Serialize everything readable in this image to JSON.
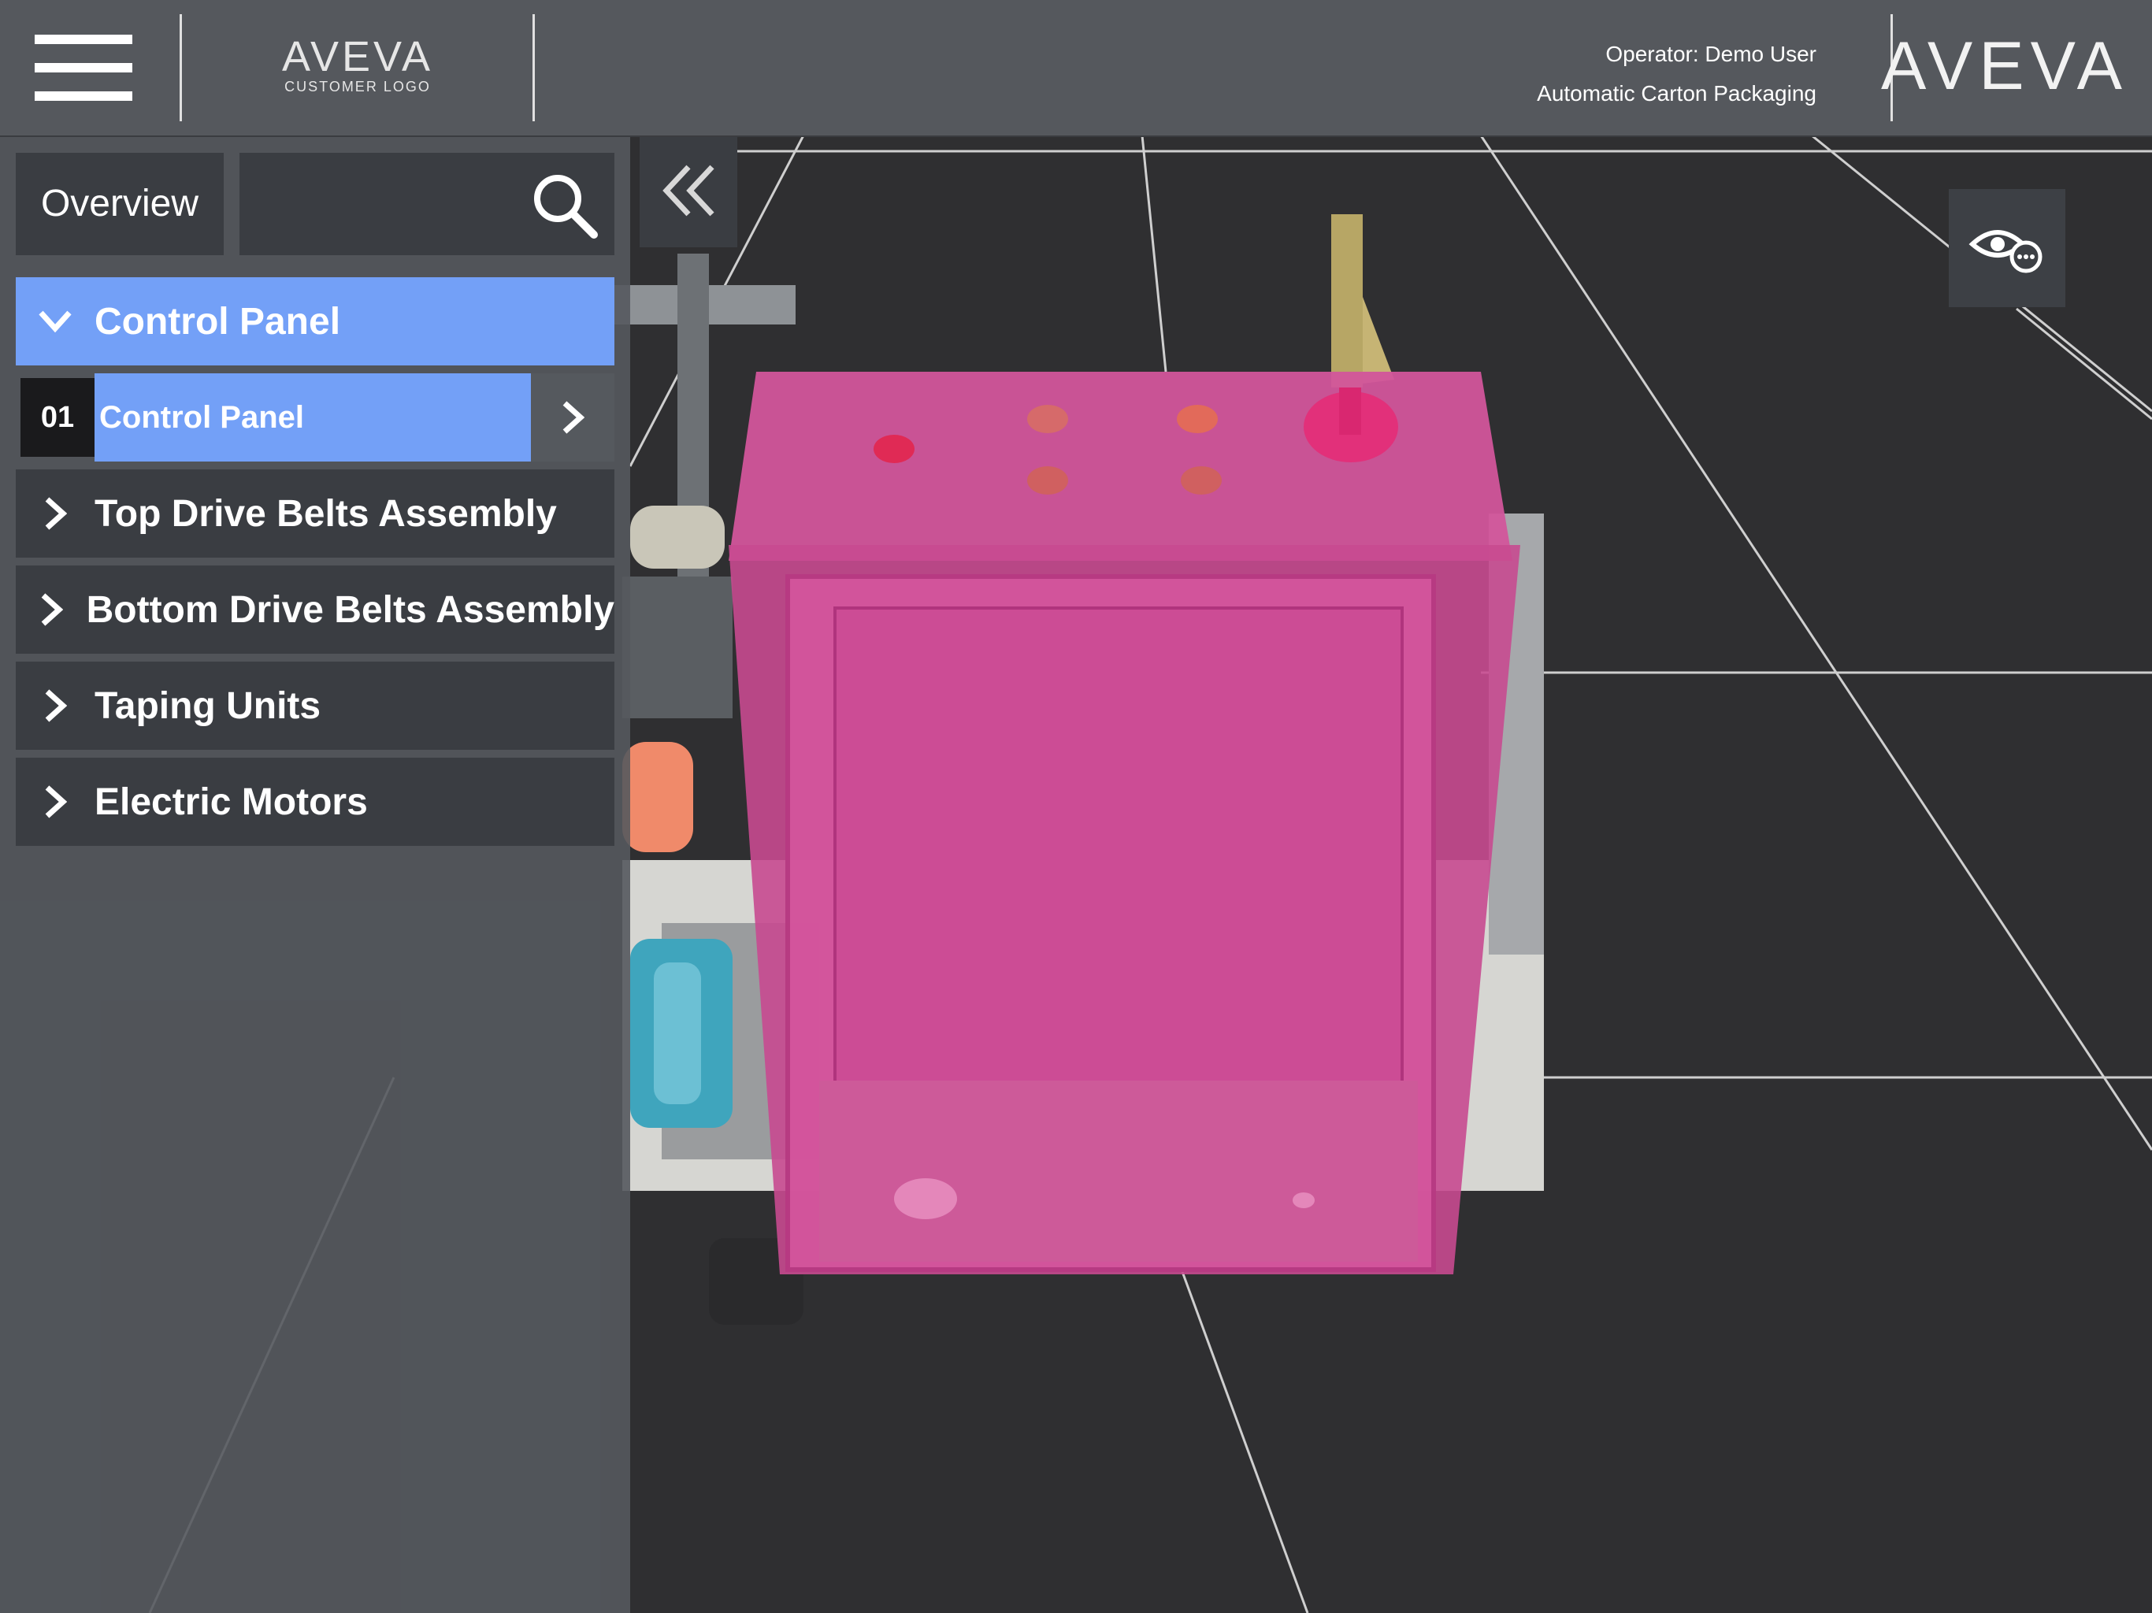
{
  "header": {
    "customer_logo": {
      "word": "AVEVA",
      "sub": "CUSTOMER LOGO"
    },
    "operator_line": "Operator: Demo User",
    "process_line": "Automatic Carton Packaging",
    "brand_logo": "AVEVA"
  },
  "sidebar": {
    "overview_label": "Overview",
    "search_placeholder": "",
    "tree": [
      {
        "label": "Control Panel",
        "expanded": true,
        "selected": true,
        "children": [
          {
            "number": "01",
            "label": "Control Panel",
            "selected": true
          }
        ]
      },
      {
        "label": "Top Drive Belts Assembly",
        "expanded": false
      },
      {
        "label": "Bottom Drive Belts Assembly",
        "expanded": false
      },
      {
        "label": "Taping Units",
        "expanded": false
      },
      {
        "label": "Electric Motors",
        "expanded": false
      }
    ]
  },
  "icons": {
    "menu": "hamburger-menu-icon",
    "search": "search-icon",
    "collapse": "double-chevron-left-icon",
    "view_options": "eye-options-icon"
  },
  "colors": {
    "topbar": "#55585d",
    "panel": "#55595e",
    "item": "#3a3d42",
    "selected": "#73a0f7",
    "highlight": "#e0379a",
    "floor": "#2f2f31"
  }
}
